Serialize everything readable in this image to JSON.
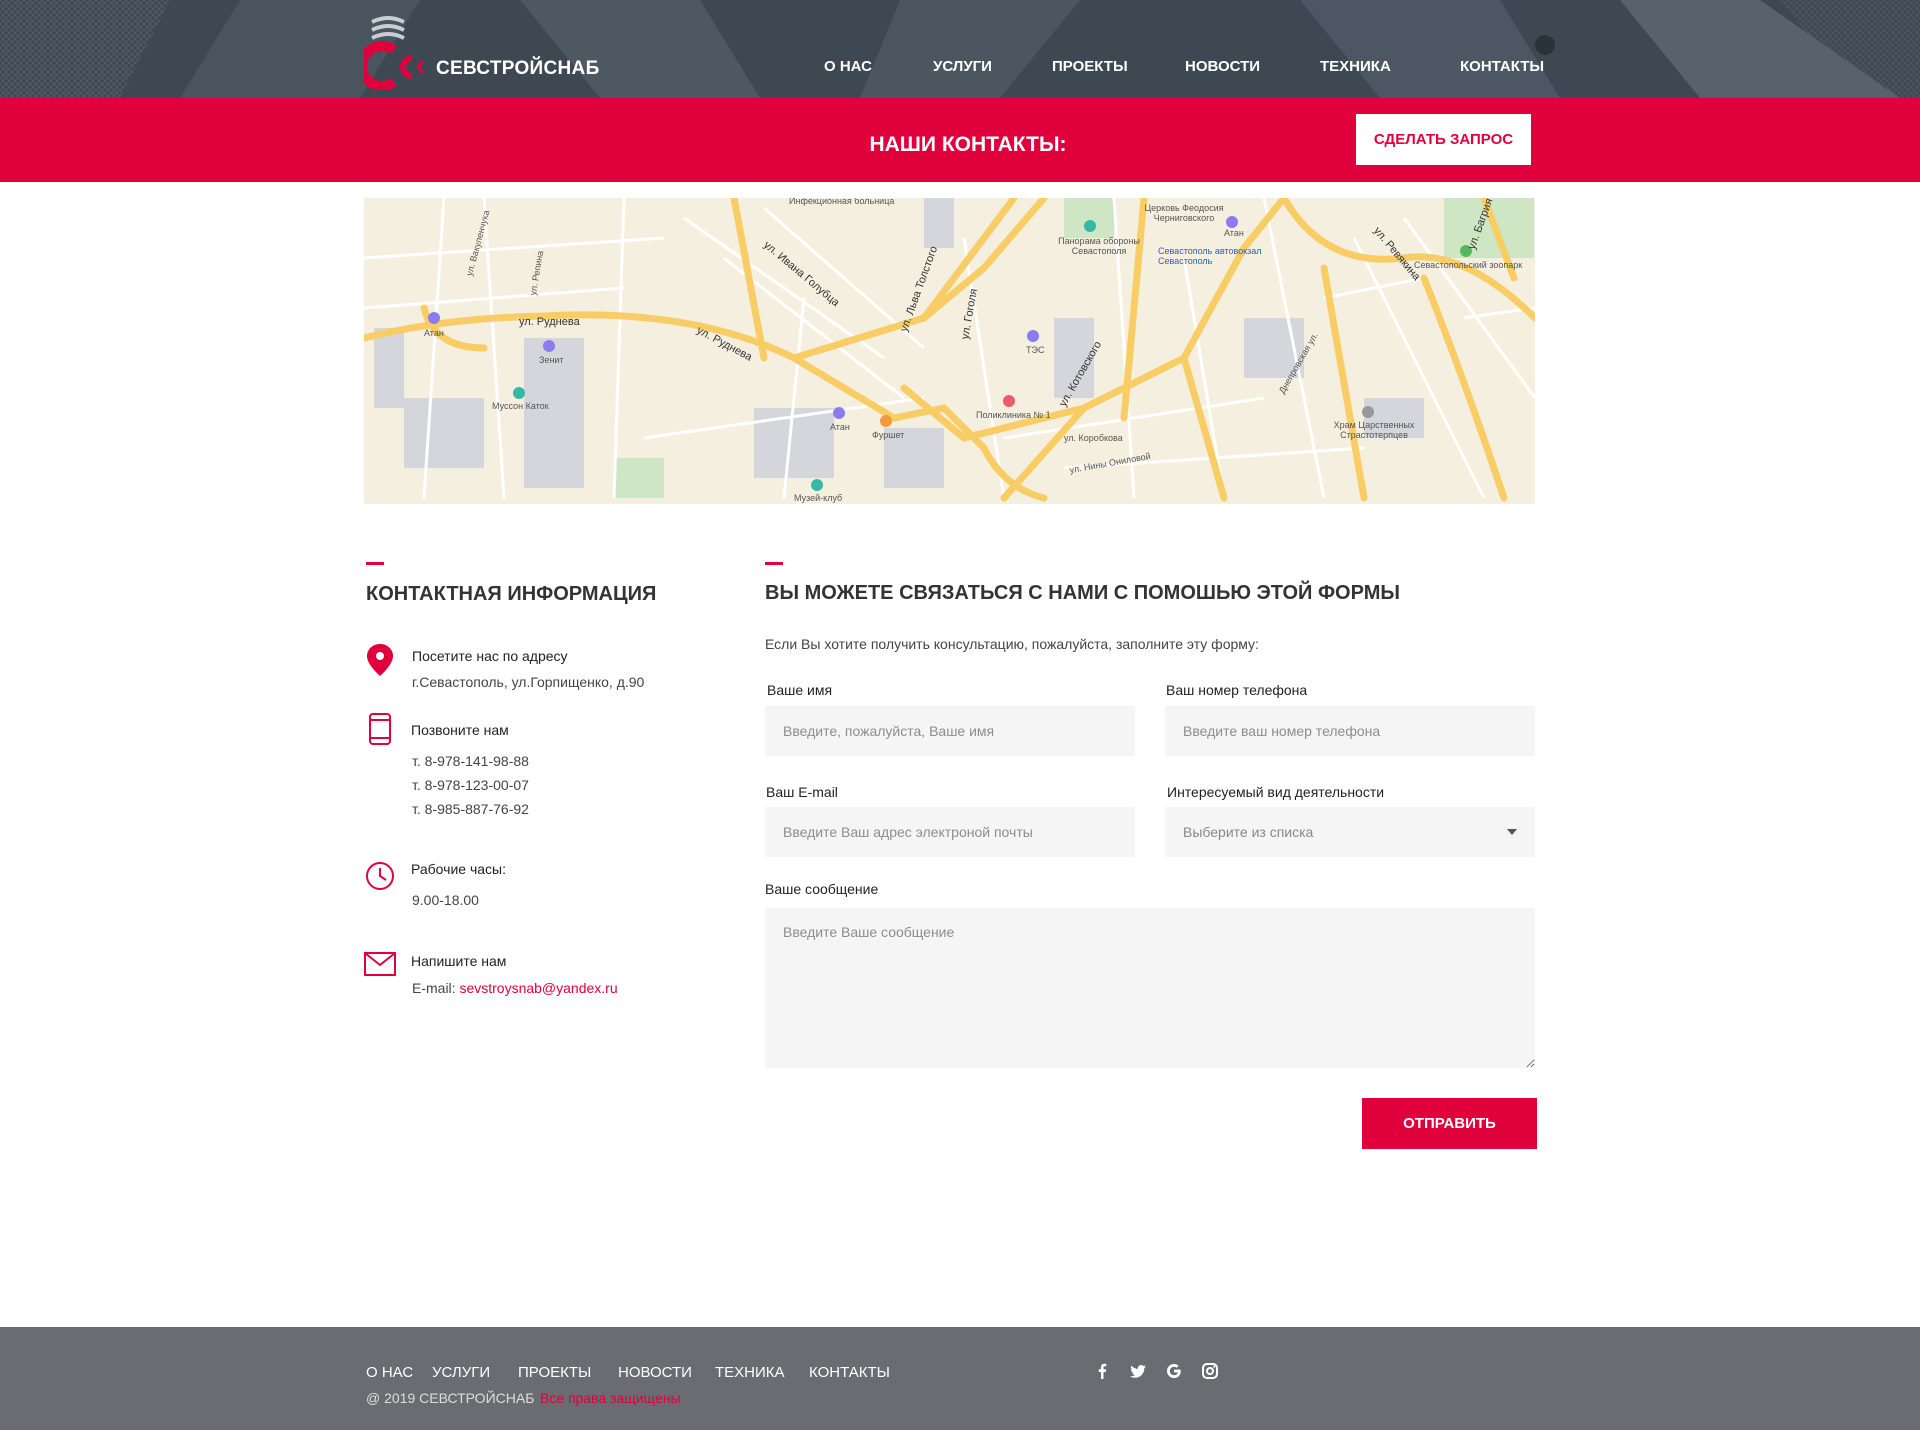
{
  "brand": {
    "name": "СЕВСТРОЙСНАБ",
    "accent_color": "#e0003c"
  },
  "nav": {
    "items": [
      "О НАС",
      "УСЛУГИ",
      "ПРОЕКТЫ",
      "НОВОСТИ",
      "ТЕХНИКА",
      "КОНТАКТЫ"
    ]
  },
  "banner": {
    "title": "НАШИ КОНТАКТЫ:",
    "request_button": "СДЕЛАТЬ ЗАПРОС"
  },
  "map": {
    "labels": [
      "ул. Руднева",
      "ул. Руднева",
      "ул. Ивана Голубца",
      "ул. Льва Толстого",
      "ул. Гоголя",
      "ул. Котовского",
      "ул. Ревякина",
      "ул. Багрия",
      "Атан",
      "Зенит",
      "Муссон Каток",
      "Атан",
      "Фуршет",
      "Музей-клуб",
      "Поликлиника № 1",
      "ТЭС",
      "Панорама обороны Севастополя",
      "Церковь Феодосия Черниговского",
      "Атан",
      "Севастополь автовокзал Севастополь",
      "Севастопольский зоопарк",
      "Храм Царственных Страстотерпцев",
      "ул. Коробкова",
      "ул. Нины Ониловой",
      "Днепровская ул.",
      "ул. Репина",
      "ул. Вакуленчука",
      "Инфекционная больница"
    ]
  },
  "contact_info": {
    "heading": "КОНТАКТНАЯ ИНФОРМАЦИЯ",
    "address_title": "Посетите нас по адресу",
    "address": "г.Севастополь,  ул.Горпищенко, д.90",
    "phone_title": "Позвоните нам",
    "phones": [
      "т. 8-978-141-98-88",
      "т. 8-978-123-00-07",
      "т. 8-985-887-76-92"
    ],
    "hours_title": "Рабочие часы:",
    "hours": "9.00-18.00",
    "mail_title": "Напишите нам",
    "email_prefix": "E-mail: ",
    "email": "sevstroysnab@yandex.ru"
  },
  "form": {
    "heading": "ВЫ МОЖЕТЕ СВЯЗАТЬСЯ С НАМИ С ПОМОШЬЮ ЭТОЙ ФОРМЫ",
    "intro": "Если Вы хотите получить консультацию, пожалуйста, заполните эту форму:",
    "name_label": "Ваше имя",
    "name_placeholder": "Введите, пожалуйста, Ваше имя",
    "phone_label": "Ваш номер телефона",
    "phone_placeholder": "Введите ваш номер телефона",
    "email_label": "Ваш E-mail",
    "email_placeholder": "Введите Ваш адрес электроной почты",
    "activity_label": "Интересуемый вид деятельности",
    "activity_value": "Выберите из списка",
    "message_label": "Ваше сообщение",
    "message_placeholder": "Введите Ваше сообщение",
    "submit": "ОТПРАВИТЬ"
  },
  "footer": {
    "nav": [
      "О НАС",
      "УСЛУГИ",
      "ПРОЕКТЫ",
      "НОВОСТИ",
      "ТЕХНИКА",
      "КОНТАКТЫ"
    ],
    "copyright": "@ 2019 СЕВСТРОЙСНАБ",
    "rights": "Все права защищены",
    "social": [
      "facebook-icon",
      "twitter-icon",
      "google-icon",
      "instagram-icon"
    ]
  }
}
